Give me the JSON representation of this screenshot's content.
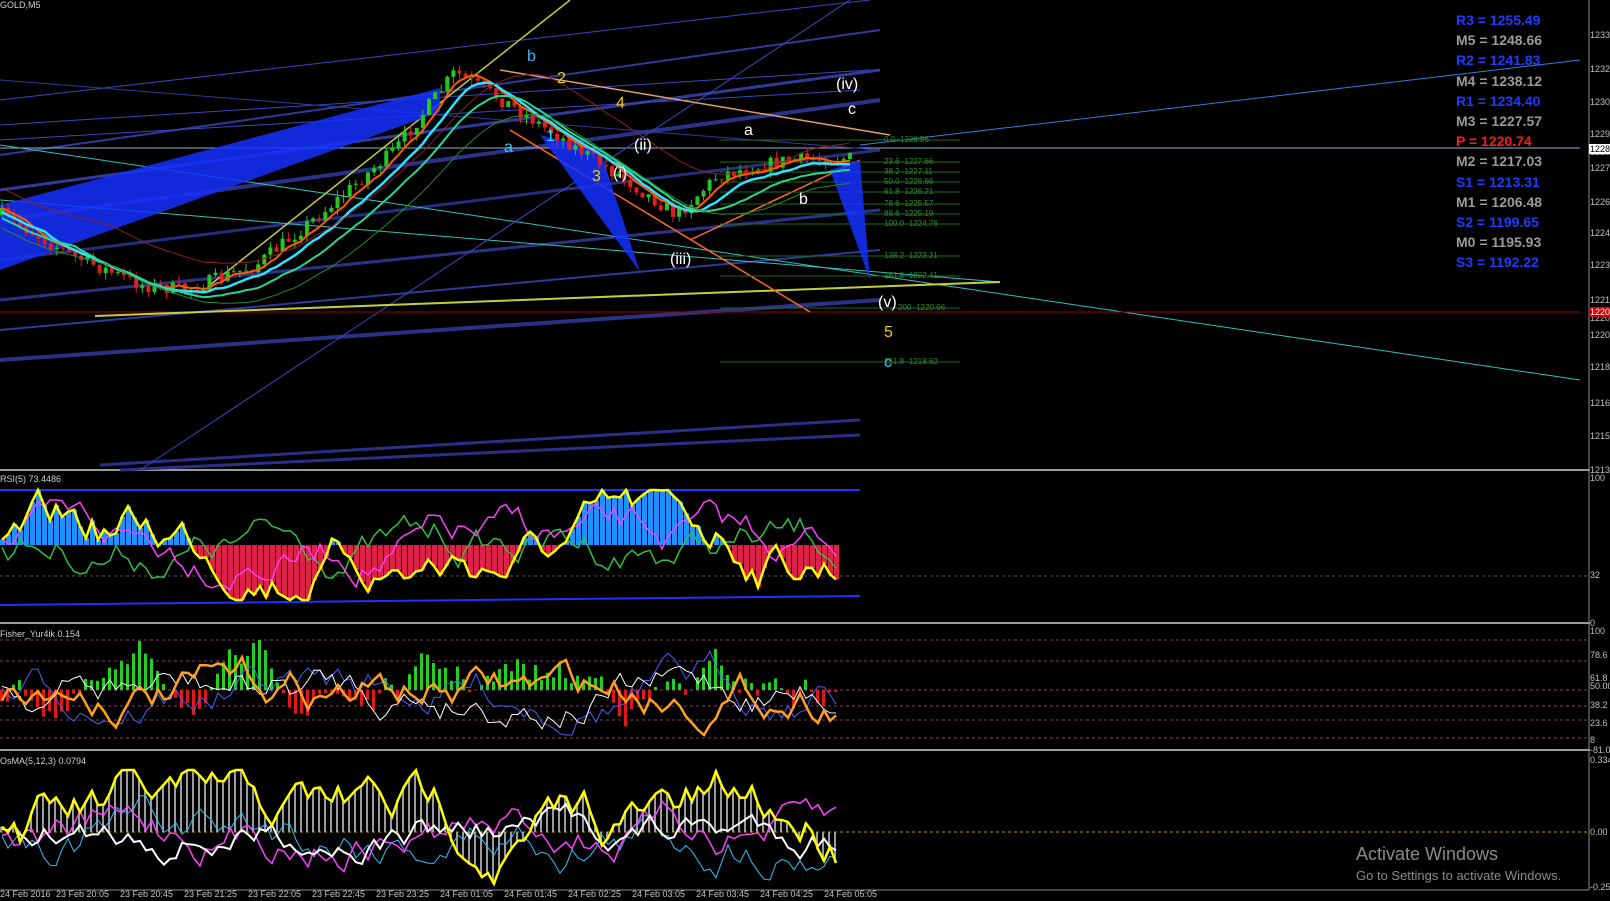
{
  "symbol_title": "GOLD,M5",
  "pivots": [
    {
      "label": "R3 = 1255.49",
      "color": "#1e3cff"
    },
    {
      "label": "M5 = 1248.66",
      "color": "#9a9a9a"
    },
    {
      "label": "R2 = 1241.83",
      "color": "#1e3cff"
    },
    {
      "label": "M4 = 1238.12",
      "color": "#9a9a9a"
    },
    {
      "label": "R1 = 1234.40",
      "color": "#1e3cff"
    },
    {
      "label": "M3 = 1227.57",
      "color": "#9a9a9a"
    },
    {
      "label": "P  = 1220.74",
      "color": "#ff1a1a"
    },
    {
      "label": "M2 = 1217.03",
      "color": "#9a9a9a"
    },
    {
      "label": "S1 = 1213.31",
      "color": "#1e3cff"
    },
    {
      "label": "M1 = 1206.48",
      "color": "#9a9a9a"
    },
    {
      "label": "S2 = 1199.65",
      "color": "#1e3cff"
    },
    {
      "label": "M0 = 1195.93",
      "color": "#9a9a9a"
    },
    {
      "label": "S3 = 1192.22",
      "color": "#1e3cff"
    }
  ],
  "price_axis": [
    "1233",
    "1232",
    "1230",
    "1229",
    "1228",
    "1227",
    "1226",
    "1224",
    "1223",
    "1221",
    "1220",
    "1220",
    "1218",
    "1216",
    "1215",
    "1213"
  ],
  "rsi": {
    "title": "RSI(5) 73.4486",
    "axis": [
      "100",
      "32",
      "0"
    ]
  },
  "fisher": {
    "title": "Fisher_Yur4ik 0.154",
    "axis": [
      "100",
      "78.6",
      "61.8",
      "50.00",
      "38.2",
      "23.6",
      "8",
      "-81.05"
    ]
  },
  "osma": {
    "title": "OsMA(5,12,3) 0.0794",
    "axis": [
      "0.334",
      "0.00",
      "-0.25"
    ]
  },
  "time_axis": [
    "24 Feb 2016",
    "23 Feb 20:05",
    "23 Feb 20:45",
    "23 Feb 21:25",
    "23 Feb 22:05",
    "23 Feb 22:45",
    "23 Feb 23:25",
    "24 Feb 01:05",
    "24 Feb 01:45",
    "24 Feb 02:25",
    "24 Feb 03:05",
    "24 Feb 03:45",
    "24 Feb 04:25",
    "24 Feb 05:05"
  ],
  "wave_labels": [
    {
      "text": "b",
      "color": "#2fb8ff"
    },
    {
      "text": "2",
      "color": "#f0d000"
    },
    {
      "text": "4",
      "color": "#f0d000"
    },
    {
      "text": "1",
      "color": "#2fd8ff"
    },
    {
      "text": "a",
      "color": "#2fd8ff"
    },
    {
      "text": "3",
      "color": "#f0d000"
    },
    {
      "text": "(ii)",
      "color": "#ffffff"
    },
    {
      "text": "(i)",
      "color": "#ffffff"
    },
    {
      "text": "(iii)",
      "color": "#ffffff"
    },
    {
      "text": "(iv)",
      "color": "#ffffff"
    },
    {
      "text": "c",
      "color": "#ffffff"
    },
    {
      "text": "a",
      "color": "#ffffff"
    },
    {
      "text": "b",
      "color": "#ffffff"
    },
    {
      "text": "(v)",
      "color": "#ffffff"
    },
    {
      "text": "5",
      "color": "#f0d000"
    },
    {
      "text": "c",
      "color": "#2fd8ff"
    }
  ],
  "fib_levels": [
    "0.0 -1228.56",
    "23.6 -1227.66",
    "38.2 -1227.11",
    "50.0 -1226.66",
    "61.8 -1226.21",
    "78.6 -1225.57",
    "88.6 -1225.19",
    "100.0 -1224.76",
    "138.2 -1223.31",
    "161.8 -1222.41",
    "200 -1220.96",
    "261.8 -1218.62"
  ],
  "current_price_tag": "1228",
  "pivot_price_tag": "1220",
  "watermark": {
    "line1": "Activate Windows",
    "line2": "Go to Settings to activate Windows."
  }
}
